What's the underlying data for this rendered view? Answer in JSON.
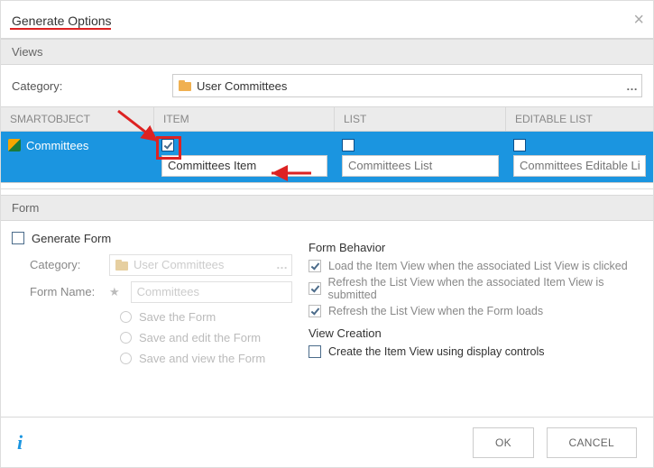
{
  "dialog": {
    "title": "Generate Options"
  },
  "views": {
    "section_label": "Views",
    "category_label": "Category:",
    "category_value": "User Committees"
  },
  "table": {
    "headers": {
      "smartobject": "SMARTOBJECT",
      "item": "ITEM",
      "list": "LIST",
      "editable_list": "EDITABLE LIST"
    },
    "row": {
      "name": "Committees",
      "item_checked": true,
      "item_value": "Committees Item",
      "list_checked": false,
      "list_placeholder": "Committees List",
      "editlist_checked": false,
      "editlist_placeholder": "Committees Editable List"
    }
  },
  "form": {
    "section_label": "Form",
    "generate_label": "Generate Form",
    "category_label": "Category:",
    "category_value": "User Committees",
    "name_label": "Form Name:",
    "name_placeholder": "Committees",
    "radios": {
      "save": "Save the Form",
      "save_edit": "Save and edit the Form",
      "save_view": "Save and view the Form"
    },
    "behavior_label": "Form Behavior",
    "behavior": {
      "opt1": "Load the Item View when the associated List View is clicked",
      "opt2": "Refresh the List View when the associated Item View is submitted",
      "opt3": "Refresh the List View when the Form loads"
    },
    "creation_label": "View Creation",
    "creation_opt": "Create the Item View using display controls"
  },
  "footer": {
    "ok": "OK",
    "cancel": "CANCEL"
  }
}
